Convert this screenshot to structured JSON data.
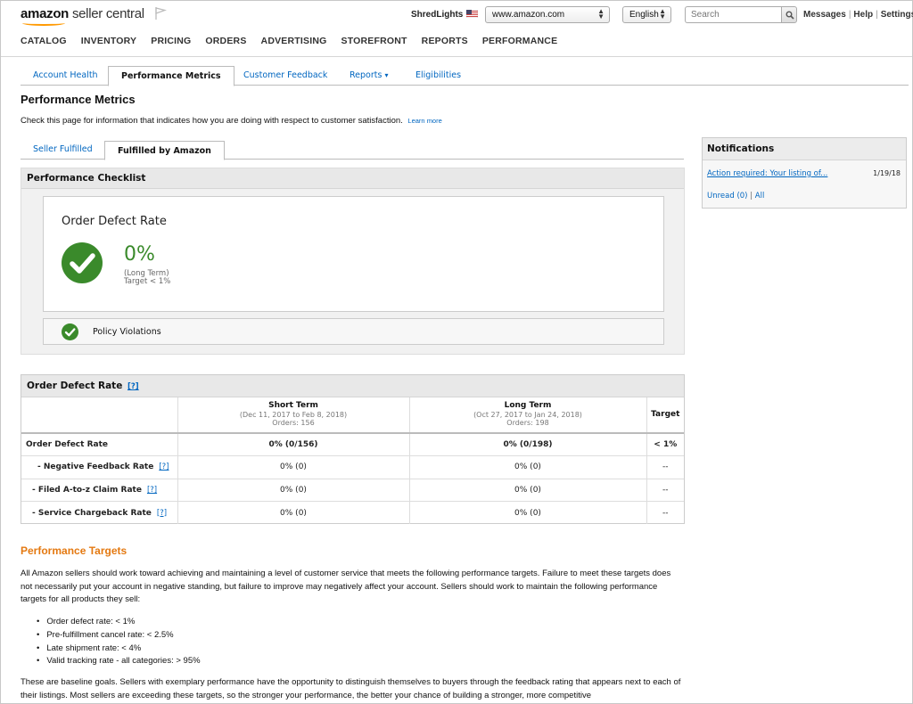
{
  "header": {
    "logo_brand": "amazon",
    "logo_product": "seller central",
    "store_name": "ShredLights",
    "marketplace": "www.amazon.com",
    "language": "English",
    "search_placeholder": "Search",
    "links": [
      "Messages",
      "Help",
      "Settings"
    ]
  },
  "main_nav": [
    "CATALOG",
    "INVENTORY",
    "PRICING",
    "ORDERS",
    "ADVERTISING",
    "STOREFRONT",
    "REPORTS",
    "PERFORMANCE"
  ],
  "sub_tabs": {
    "account_health": "Account Health",
    "performance_metrics": "Performance Metrics",
    "customer_feedback": "Customer Feedback",
    "reports": "Reports",
    "reports_caret": "▾",
    "eligibilities": "Eligibilities"
  },
  "page": {
    "title": "Performance Metrics",
    "description": "Check this page for information that indicates how you are doing with respect to customer satisfaction.",
    "learn_more": "Learn more"
  },
  "fulfillment_tabs": {
    "seller": "Seller Fulfilled",
    "fba": "Fulfilled by Amazon"
  },
  "checklist": {
    "title": "Performance Checklist",
    "odr_title": "Order Defect Rate",
    "odr_value": "0%",
    "odr_term": "(Long Term)",
    "odr_target": "Target < 1%",
    "policy_label": "Policy Violations"
  },
  "odr_table": {
    "title": "Order Defect Rate",
    "help": "[?]",
    "columns": {
      "short_term": "Short Term",
      "short_range": "(Dec 11, 2017 to Feb 8, 2018)",
      "short_orders": "Orders: 156",
      "long_term": "Long Term",
      "long_range": "(Oct 27, 2017 to Jan 24, 2018)",
      "long_orders": "Orders: 198",
      "target": "Target"
    },
    "rows": [
      {
        "label": "Order Defect Rate",
        "short": "0% (0/156)",
        "long": "0% (0/198)",
        "target": "< 1%"
      },
      {
        "label": "- Negative Feedback Rate",
        "short": "0% (0)",
        "long": "0% (0)",
        "target": "--"
      },
      {
        "label": "- Filed A-to-z Claim Rate",
        "short": "0% (0)",
        "long": "0% (0)",
        "target": "--"
      },
      {
        "label": "- Service Chargeback Rate",
        "short": "0% (0)",
        "long": "0% (0)",
        "target": "--"
      }
    ]
  },
  "targets": {
    "title": "Performance Targets",
    "para1": "All Amazon sellers should work toward achieving and maintaining a level of customer service that meets the following performance targets. Failure to meet these targets does not necessarily put your account in negative standing, but failure to improve may negatively affect your account. Sellers should work to maintain the following performance targets for all products they sell:",
    "items": [
      "Order defect rate: < 1%",
      "Pre-fulfillment cancel rate: < 2.5%",
      "Late shipment rate: < 4%",
      "Valid tracking rate - all categories: > 95%"
    ],
    "para2": "These are baseline goals. Sellers with exemplary performance have the opportunity to distinguish themselves to buyers through the feedback rating that appears next to each of their listings. Most sellers are exceeding these targets, so the stronger your performance, the better your chance of building a stronger, more competitive"
  },
  "notifications": {
    "title": "Notifications",
    "item_link": "Action required: Your listing of...",
    "item_date": "1/19/18",
    "unread": "Unread (0)",
    "all": "All"
  },
  "colors": {
    "link": "#0066c0",
    "success_green": "#3a8a2b",
    "section_orange": "#e47911"
  }
}
